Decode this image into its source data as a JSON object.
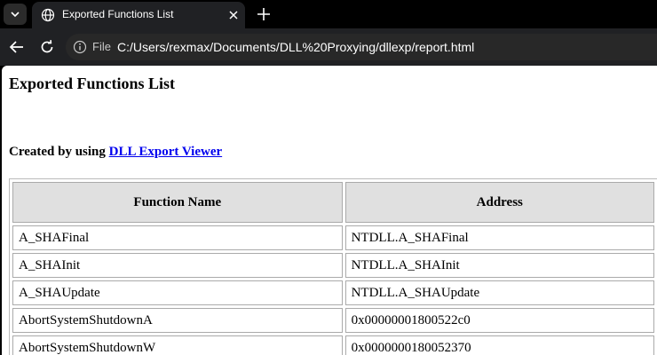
{
  "browser": {
    "tab": {
      "title": "Exported Functions List"
    },
    "address_bar": {
      "scheme_label": "File",
      "url": "C:/Users/rexmax/Documents/DLL%20Proxying/dllexp/report.html"
    }
  },
  "page": {
    "heading": "Exported Functions List",
    "credit_prefix": "Created by using",
    "credit_link": "DLL Export Viewer",
    "table": {
      "headers": [
        "Function Name",
        "Address"
      ],
      "rows": [
        {
          "name": "A_SHAFinal",
          "address": "NTDLL.A_SHAFinal"
        },
        {
          "name": "A_SHAInit",
          "address": "NTDLL.A_SHAInit"
        },
        {
          "name": "A_SHAUpdate",
          "address": "NTDLL.A_SHAUpdate"
        },
        {
          "name": "AbortSystemShutdownA",
          "address": "0x00000001800522c0"
        },
        {
          "name": "AbortSystemShutdownW",
          "address": "0x0000000180052370"
        }
      ]
    }
  }
}
